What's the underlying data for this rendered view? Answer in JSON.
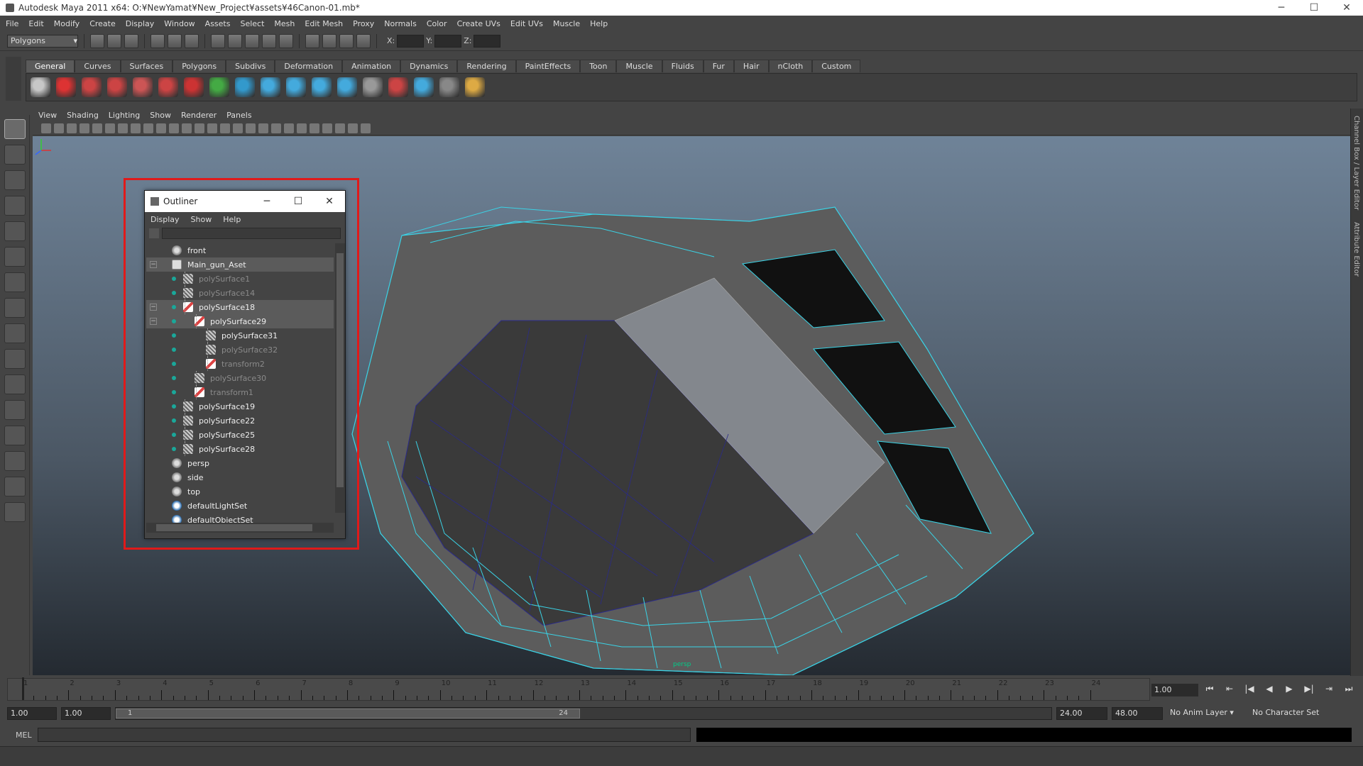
{
  "window": {
    "title": "Autodesk Maya 2011 x64: O:¥NewYamat¥New_Project¥assets¥46Canon-01.mb*",
    "minimize": "─",
    "maximize": "☐",
    "close": "✕"
  },
  "menubar": [
    "File",
    "Edit",
    "Modify",
    "Create",
    "Display",
    "Window",
    "Assets",
    "Select",
    "Mesh",
    "Edit Mesh",
    "Proxy",
    "Normals",
    "Color",
    "Create UVs",
    "Edit UVs",
    "Muscle",
    "Help"
  ],
  "statusline": {
    "mode": "Polygons",
    "x_label": "X:",
    "y_label": "Y:",
    "z_label": "Z:"
  },
  "shelf": {
    "tabs": [
      "General",
      "Curves",
      "Surfaces",
      "Polygons",
      "Subdivs",
      "Deformation",
      "Animation",
      "Dynamics",
      "Rendering",
      "PaintEffects",
      "Toon",
      "Muscle",
      "Fluids",
      "Fur",
      "Hair",
      "nCloth",
      "Custom"
    ],
    "active_tab": "General",
    "icon_colors": [
      "#c8c8c8",
      "#d33",
      "#c44",
      "#c44",
      "#c55",
      "#c44",
      "#c33",
      "#4a4",
      "#39c",
      "#4ad",
      "#4ad",
      "#4ad",
      "#4ad",
      "#999",
      "#c44",
      "#4ad",
      "#888",
      "#da4"
    ]
  },
  "panel": {
    "menus": [
      "View",
      "Shading",
      "Lighting",
      "Show",
      "Renderer",
      "Panels"
    ],
    "camera_label": "persp"
  },
  "right_tabs": {
    "channel_box": "Channel Box / Layer Editor",
    "attribute_editor": "Attribute Editor"
  },
  "outliner": {
    "title": "Outliner",
    "menus": [
      "Display",
      "Show",
      "Help"
    ],
    "rows": [
      {
        "label": "front",
        "type": "cam",
        "depth": 0,
        "dim": false
      },
      {
        "label": "Main_gun_Aset",
        "type": "grp",
        "depth": 0,
        "dim": false,
        "expand": "−",
        "selected": true
      },
      {
        "label": "polySurface1",
        "type": "mesh",
        "depth": 1,
        "dim": true,
        "vis": true
      },
      {
        "label": "polySurface14",
        "type": "mesh",
        "depth": 1,
        "dim": true,
        "vis": true
      },
      {
        "label": "polySurface18",
        "type": "xf",
        "depth": 1,
        "dim": false,
        "vis": true,
        "expand": "−",
        "selected": true
      },
      {
        "label": "polySurface29",
        "type": "xf",
        "depth": 2,
        "dim": false,
        "vis": true,
        "expand": "−",
        "selected": true
      },
      {
        "label": "polySurface31",
        "type": "mesh",
        "depth": 3,
        "dim": false,
        "vis": true
      },
      {
        "label": "polySurface32",
        "type": "mesh",
        "depth": 3,
        "dim": true,
        "vis": true
      },
      {
        "label": "transform2",
        "type": "xf",
        "depth": 3,
        "dim": true,
        "vis": true
      },
      {
        "label": "polySurface30",
        "type": "mesh",
        "depth": 2,
        "dim": true,
        "vis": true
      },
      {
        "label": "transform1",
        "type": "xf",
        "depth": 2,
        "dim": true,
        "vis": true
      },
      {
        "label": "polySurface19",
        "type": "mesh",
        "depth": 1,
        "dim": false,
        "vis": true
      },
      {
        "label": "polySurface22",
        "type": "mesh",
        "depth": 1,
        "dim": false,
        "vis": true
      },
      {
        "label": "polySurface25",
        "type": "mesh",
        "depth": 1,
        "dim": false,
        "vis": true
      },
      {
        "label": "polySurface28",
        "type": "mesh",
        "depth": 1,
        "dim": false,
        "vis": true
      },
      {
        "label": "persp",
        "type": "cam",
        "depth": 0,
        "dim": false
      },
      {
        "label": "side",
        "type": "cam",
        "depth": 0,
        "dim": false
      },
      {
        "label": "top",
        "type": "cam",
        "depth": 0,
        "dim": false
      },
      {
        "label": "defaultLightSet",
        "type": "light",
        "depth": 0,
        "dim": false
      },
      {
        "label": "defaultObjectSet",
        "type": "light",
        "depth": 0,
        "dim": false
      }
    ]
  },
  "timeline": {
    "start": 1,
    "end": 24,
    "current_frame": "1.00"
  },
  "playback": [
    "⏮",
    "⇤",
    "|◀",
    "◀",
    "▶",
    "▶|",
    "⇥",
    "⏭"
  ],
  "range": {
    "start": "1.00",
    "playback_start": "1.00",
    "thumb_start": "1",
    "thumb_end": "24",
    "playback_end": "24.00",
    "end": "48.00",
    "anim_layer": "No Anim Layer",
    "character_set": "No Character Set"
  },
  "cmdline": {
    "label": "MEL"
  }
}
